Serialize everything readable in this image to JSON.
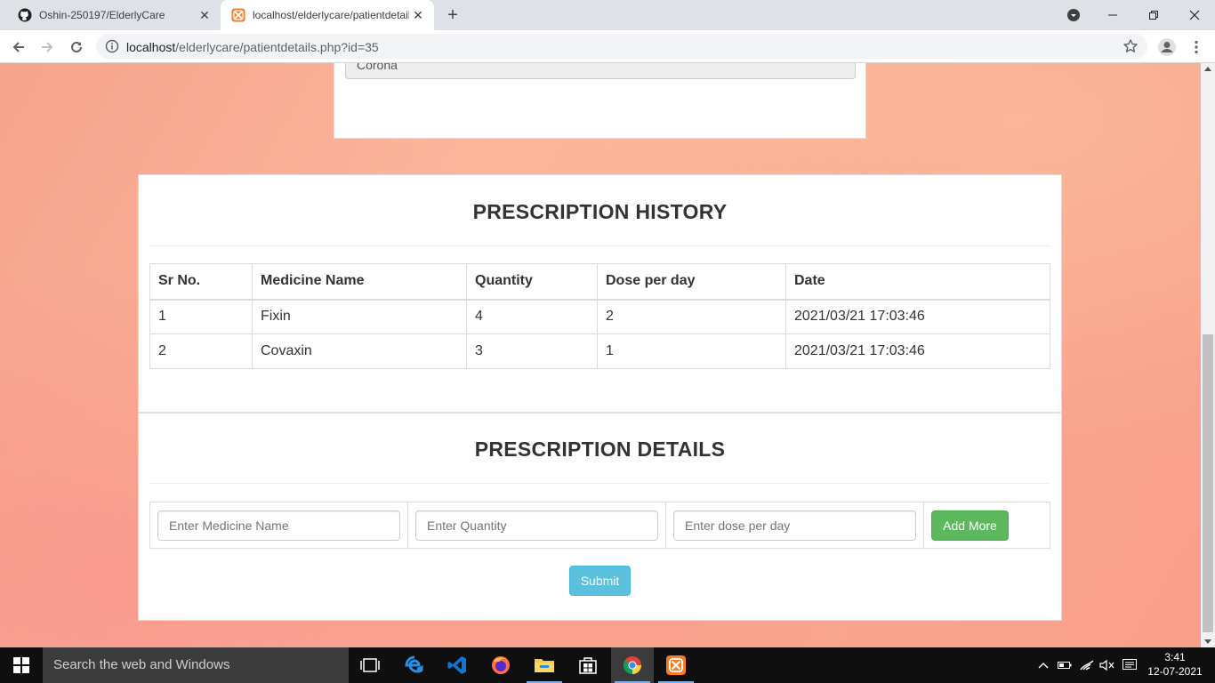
{
  "browser": {
    "tabs": [
      {
        "title": "Oshin-250197/ElderlyCare",
        "icon": "github-icon",
        "active": false
      },
      {
        "title": "localhost/elderlycare/patientdetails.php?id=35",
        "icon": "xampp-icon",
        "active": true
      }
    ],
    "url_host": "localhost",
    "url_path": "/elderlycare/patientdetails.php?id=35"
  },
  "patient_card": {
    "disease_value": "Corona"
  },
  "history": {
    "title": "PRESCRIPTION HISTORY",
    "columns": [
      "Sr No.",
      "Medicine Name",
      "Quantity",
      "Dose per day",
      "Date"
    ],
    "rows": [
      [
        "1",
        "Fixin",
        "4",
        "2",
        "2021/03/21 17:03:46"
      ],
      [
        "2",
        "Covaxin",
        "3",
        "1",
        "2021/03/21 17:03:46"
      ]
    ]
  },
  "details": {
    "title": "PRESCRIPTION DETAILS",
    "medicine_placeholder": "Enter Medicine Name",
    "quantity_placeholder": "Enter Quantity",
    "dose_placeholder": "Enter dose per day",
    "add_more_label": "Add More",
    "submit_label": "Submit"
  },
  "taskbar": {
    "search_placeholder": "Search the web and Windows",
    "time": "3:41",
    "date": "12-07-2021"
  },
  "colors": {
    "success": "#5cb85c",
    "info": "#5bc0de",
    "background_gradient": "#f9a58d"
  }
}
